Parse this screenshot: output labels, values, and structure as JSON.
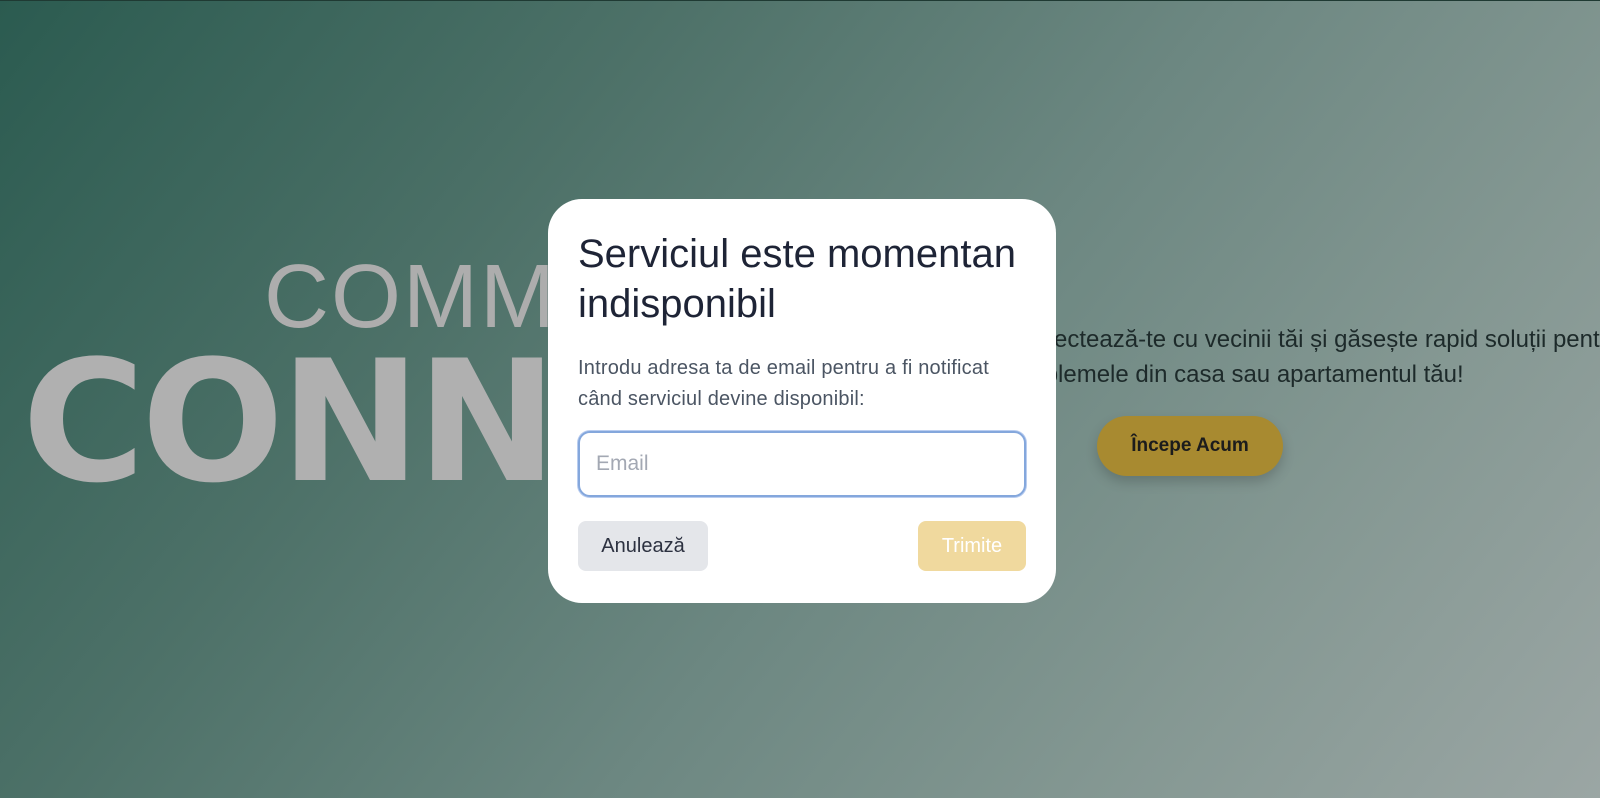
{
  "hero": {
    "brand_line1": "COMMUNITY",
    "brand_line2": "CONNECT",
    "text_line1": "Conectează-te cu vecinii tăi și găsește rapid soluții pentru",
    "text_line2": "problemele din casa sau apartamentul tău!",
    "cta_label": "Începe Acum"
  },
  "modal": {
    "title": "Serviciul este momentan indisponibil",
    "description": "Introdu adresa ta de email pentru a fi notificat când serviciul devine disponibil:",
    "email_placeholder": "Email",
    "email_value": "",
    "cancel_label": "Anulează",
    "submit_label": "Trimite"
  },
  "colors": {
    "accent": "#a88a30",
    "submit_disabled": "#f0d99e",
    "input_focus": "#84a7dc"
  }
}
